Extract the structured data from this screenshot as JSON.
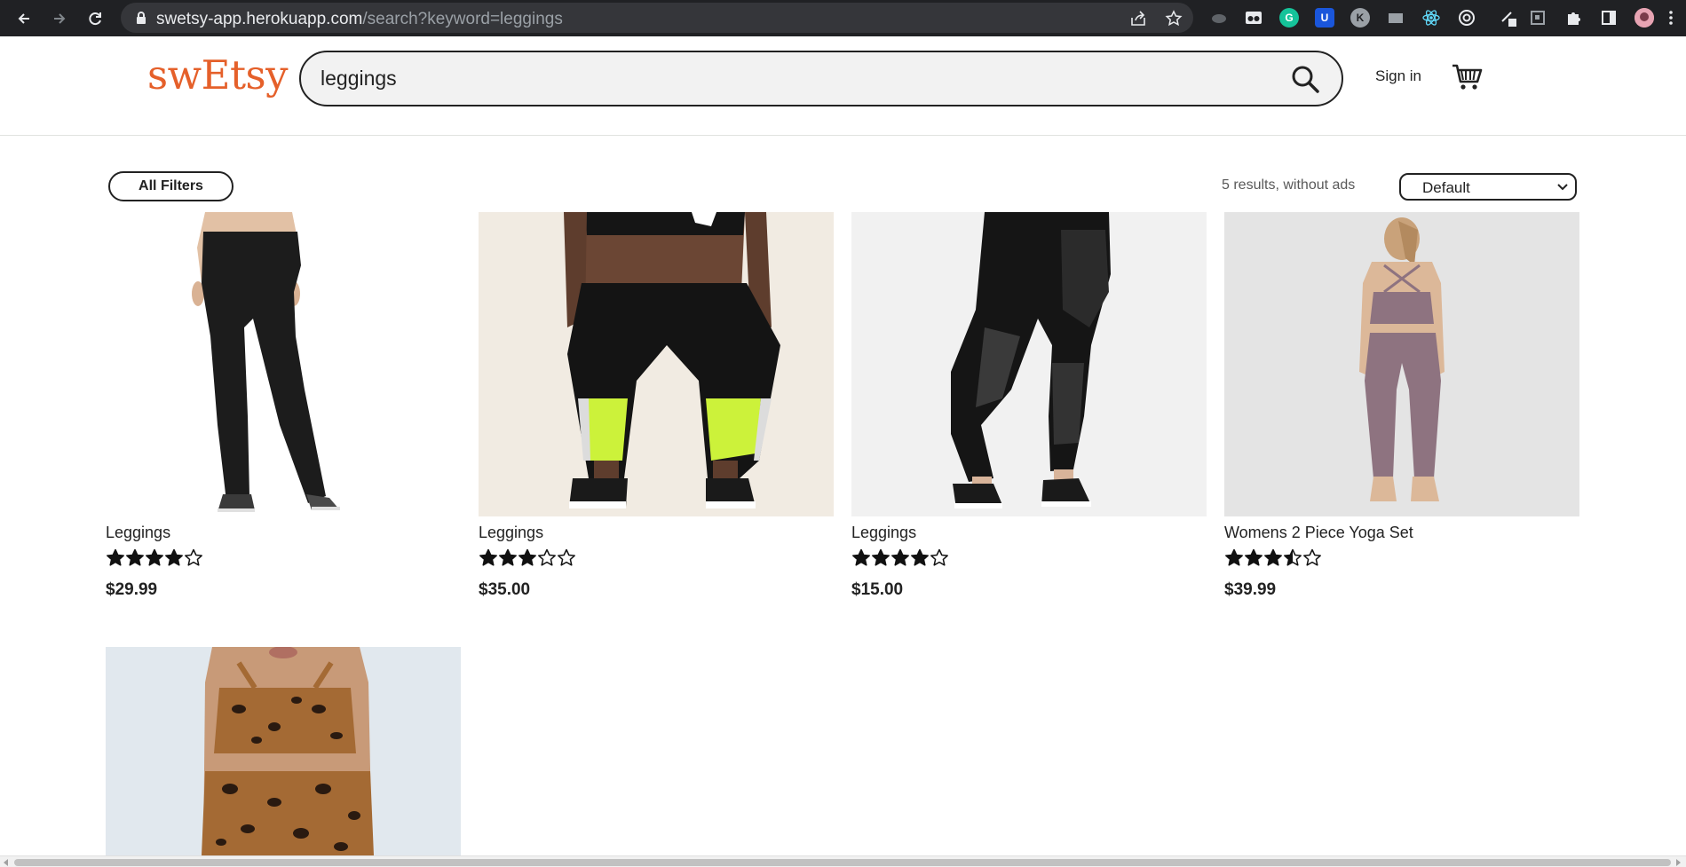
{
  "browser": {
    "url_host": "swetsy-app.herokuapp.com",
    "url_path": "/search?keyword=leggings"
  },
  "header": {
    "logo": "swEtsy",
    "search_value": "leggings",
    "signin_label": "Sign in"
  },
  "toolbar": {
    "filters_label": "All Filters",
    "results_text": "5 results, without ads",
    "sort_selected": "Default"
  },
  "products": [
    {
      "title": "Leggings",
      "rating": 4,
      "price": "$29.99"
    },
    {
      "title": "Leggings",
      "rating": 3,
      "price": "$35.00"
    },
    {
      "title": "Leggings",
      "rating": 4,
      "price": "$15.00"
    },
    {
      "title": "Womens 2 Piece Yoga Set",
      "rating": 3.5,
      "price": "$39.99"
    },
    {
      "title": "",
      "rating": null,
      "price": ""
    }
  ],
  "colors": {
    "brand": "#e5602a",
    "chrome": "#202124"
  }
}
